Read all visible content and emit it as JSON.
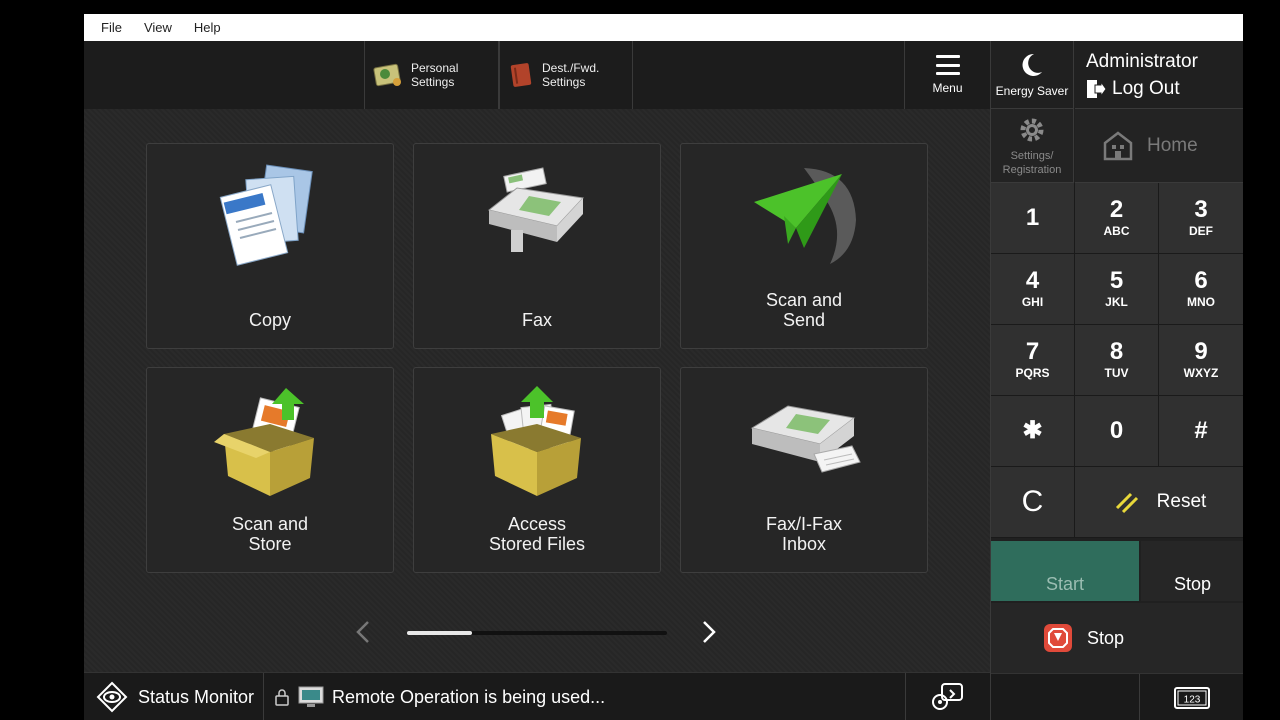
{
  "menubar": {
    "file": "File",
    "view": "View",
    "help": "Help"
  },
  "topbar": {
    "personal_settings": "Personal\nSettings",
    "dest_settings": "Dest./Fwd.\nSettings",
    "menu": "Menu"
  },
  "tiles": [
    {
      "label": "Copy"
    },
    {
      "label": "Fax"
    },
    {
      "label": "Scan and\nSend"
    },
    {
      "label": "Scan and\nStore"
    },
    {
      "label": "Access\nStored Files"
    },
    {
      "label": "Fax/I-Fax\nInbox"
    }
  ],
  "pager": {
    "progress": 0.25
  },
  "statusbar": {
    "status_monitor": "Status Monitor",
    "remote_message": "Remote Operation is being used..."
  },
  "right": {
    "energy_saver": "Energy Saver",
    "admin_name": "Administrator",
    "logout": "Log Out",
    "settings": "Settings/\nRegistration",
    "home": "Home"
  },
  "keypad": [
    {
      "d": "1",
      "s": ""
    },
    {
      "d": "2",
      "s": "ABC"
    },
    {
      "d": "3",
      "s": "DEF"
    },
    {
      "d": "4",
      "s": "GHI"
    },
    {
      "d": "5",
      "s": "JKL"
    },
    {
      "d": "6",
      "s": "MNO"
    },
    {
      "d": "7",
      "s": "PQRS"
    },
    {
      "d": "8",
      "s": "TUV"
    },
    {
      "d": "9",
      "s": "WXYZ"
    },
    {
      "d": "✱",
      "s": ""
    },
    {
      "d": "0",
      "s": ""
    },
    {
      "d": "#",
      "s": ""
    }
  ],
  "controls": {
    "clear": "C",
    "reset": "Reset",
    "start": "Start",
    "stop": "Stop",
    "stop_large": "Stop",
    "keyboard_label": "123"
  },
  "colors": {
    "start_bg": "#2f6d5c",
    "accent_green": "#4cc22a",
    "stop_red": "#e04a3a"
  }
}
